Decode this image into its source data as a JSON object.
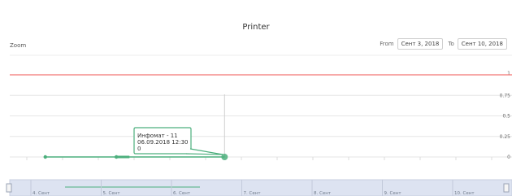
{
  "chart_data": {
    "type": "line",
    "title": "Printer",
    "zoom_label": "Zoom",
    "range": {
      "from_label": "From",
      "from_value": "Сент 3, 2018",
      "to_label": "To",
      "to_value": "Сент 10, 2018"
    },
    "y_ticks": [
      "1",
      "0.75",
      "0.5",
      "0.25",
      "0"
    ],
    "ylim": [
      0,
      1
    ],
    "threshold": {
      "value": 1,
      "color": "#ef5350"
    },
    "series": [
      {
        "name": "Инфомат - 11",
        "color": "#4caf7d",
        "points": [
          {
            "x": "04.09.2018",
            "y": 0
          },
          {
            "x": "05.09.2018",
            "y": 0
          },
          {
            "x": "06.09.2018 12:30",
            "y": 0
          }
        ]
      }
    ],
    "tooltip": {
      "line1": "Инфомат - 11",
      "line2": "06.09.2018 12:30",
      "line3": "0"
    },
    "navigator_ticks": [
      "4. Сент",
      "5. Сент",
      "6. Сент",
      "7. Сент",
      "8. Сент",
      "9. Сент",
      "10. Сент"
    ]
  }
}
